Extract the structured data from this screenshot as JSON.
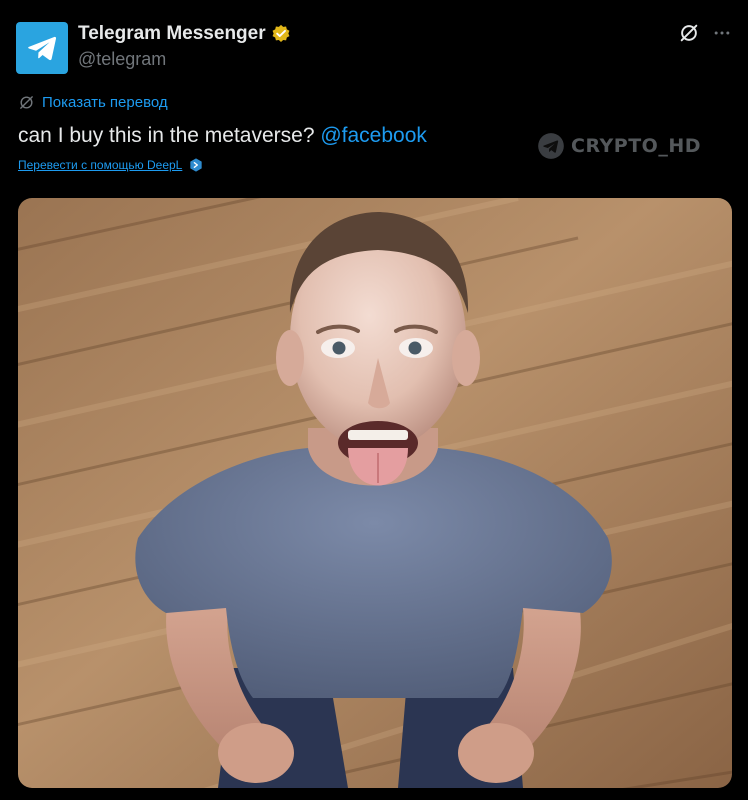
{
  "tweet": {
    "display_name": "Telegram Messenger",
    "handle": "@telegram",
    "show_translation": "Показать перевод",
    "text_main": "can I buy this in the metaverse? ",
    "mention": "@facebook",
    "deepl_link": "Перевести с помощью DeepL",
    "watermark": "CRYPTO_HD"
  },
  "colors": {
    "background": "#000000",
    "text": "#e7e9ea",
    "muted": "#71767b",
    "accent": "#1d9bf0",
    "avatar_bg": "#2aa4e0",
    "verified_badge": "#e2b719"
  },
  "icons": {
    "avatar": "telegram-paper-plane-icon",
    "verified": "verified-badge-icon",
    "grok": "grok-icon",
    "more": "more-dots-icon",
    "translate": "translate-icon",
    "deepl": "deepl-icon",
    "watermark": "telegram-watermark-icon"
  }
}
